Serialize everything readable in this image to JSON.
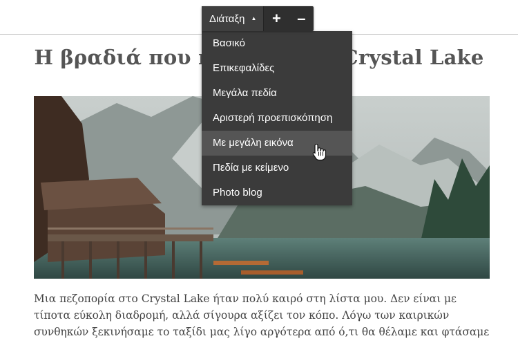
{
  "toolbar": {
    "layout_label": "Διάταξη",
    "caret_glyph": "▲",
    "plus_label": "+",
    "minus_label": "–"
  },
  "menu": {
    "items": [
      {
        "label": "Βασικό"
      },
      {
        "label": "Επικεφαλίδες"
      },
      {
        "label": "Μεγάλα πεδία"
      },
      {
        "label": "Αριστερή προεπισκόπηση"
      },
      {
        "label": "Με μεγάλη εικόνα",
        "hovered": true
      },
      {
        "label": "Πεδία με κείμενο"
      },
      {
        "label": "Photo blog"
      }
    ]
  },
  "article": {
    "title": "Η βραδιά που πέρασα στη Crystal Lake",
    "body": "Μια πεζοπορία στο Crystal Lake ήταν πολύ καιρό στη λίστα μου. Δεν είναι με τίποτα εύκολη διαδρομή, αλλά σίγουρα αξίζει τον κόπο. Λόγω των καιρικών συνθηκών ξεκινήσαμε το ταξίδι μας λίγο αργότερα από ό,τι θα θέλαμε και φτάσαμε στη λίμνη τη"
  },
  "colors": {
    "toolbar_bg": "#2f2f2f",
    "menu_bg": "#3b3b3b",
    "menu_hover": "#555555",
    "title_text": "#555555",
    "body_text": "#444444"
  },
  "icons": {
    "cursor": "hand-pointer-icon"
  }
}
